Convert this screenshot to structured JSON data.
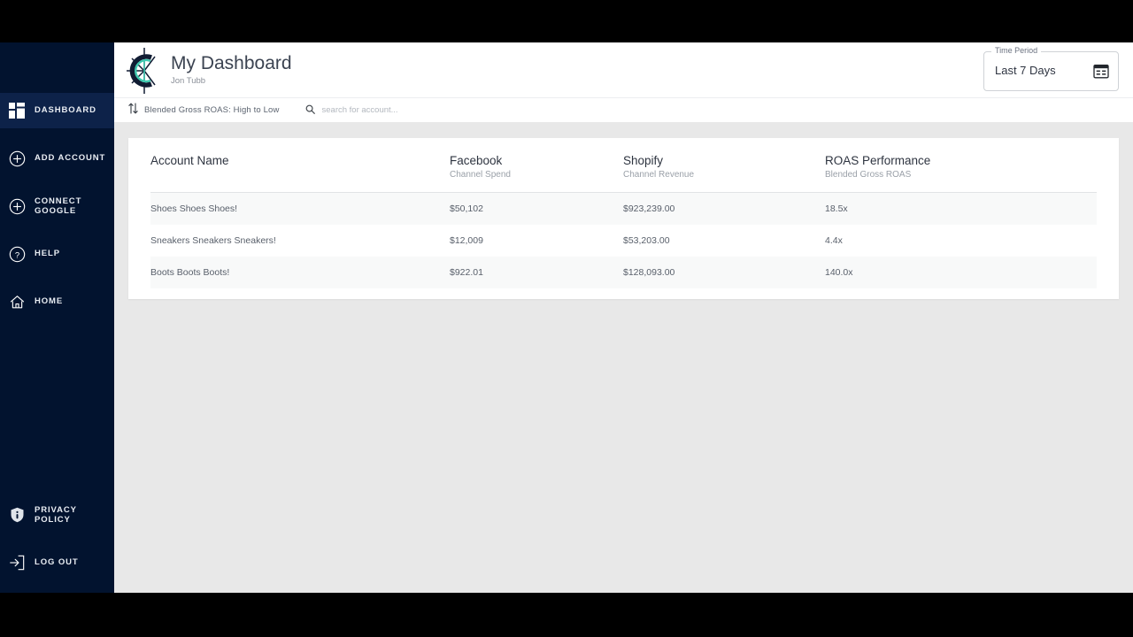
{
  "theme": {
    "sidebar_bg": "#02132f",
    "sidebar_active_bg": "#0d2249",
    "page_bg": "#e8e8e8",
    "card_bg": "#ffffff",
    "row_alt_bg": "#f8f9f9",
    "logo_accent": "#3ec9b0"
  },
  "sidebar": {
    "top_items": [
      {
        "label": "DASHBOARD",
        "icon": "dashboard-grid-icon",
        "active": true
      },
      {
        "label": "ADD ACCOUNT",
        "icon": "plus-circle-icon",
        "active": false
      },
      {
        "label": "CONNECT GOOGLE",
        "icon": "plus-circle-icon",
        "active": false
      },
      {
        "label": "HELP",
        "icon": "question-circle-icon",
        "active": false
      },
      {
        "label": "HOME",
        "icon": "home-icon",
        "active": false
      }
    ],
    "bottom_items": [
      {
        "label": "PRIVACY POLICY",
        "icon": "shield-info-icon"
      },
      {
        "label": "LOG OUT",
        "icon": "logout-arrow-icon"
      }
    ]
  },
  "header": {
    "logo_icon": "compass-logo-icon",
    "title": "My Dashboard",
    "subtitle": "Jon Tubb",
    "time_period": {
      "legend": "Time Period",
      "value": "Last 7 Days",
      "icon": "calendar-icon"
    }
  },
  "toolbar": {
    "sort_icon": "sort-arrows-icon",
    "sort_label": "Blended Gross ROAS: High to Low",
    "search_icon": "search-icon",
    "search_value": "",
    "search_placeholder": "search for account..."
  },
  "table": {
    "columns": [
      {
        "main": "Account Name",
        "sub": ""
      },
      {
        "main": "Facebook",
        "sub": "Channel Spend"
      },
      {
        "main": "Shopify",
        "sub": "Channel Revenue"
      },
      {
        "main": "ROAS Performance",
        "sub": "Blended Gross ROAS"
      }
    ],
    "rows": [
      {
        "account": "Shoes Shoes Shoes!",
        "spend": "$50,102",
        "revenue": "$923,239.00",
        "roas": "18.5x"
      },
      {
        "account": "Sneakers Sneakers Sneakers!",
        "spend": "$12,009",
        "revenue": "$53,203.00",
        "roas": "4.4x"
      },
      {
        "account": "Boots Boots Boots!",
        "spend": "$922.01",
        "revenue": "$128,093.00",
        "roas": "140.0x"
      }
    ]
  }
}
